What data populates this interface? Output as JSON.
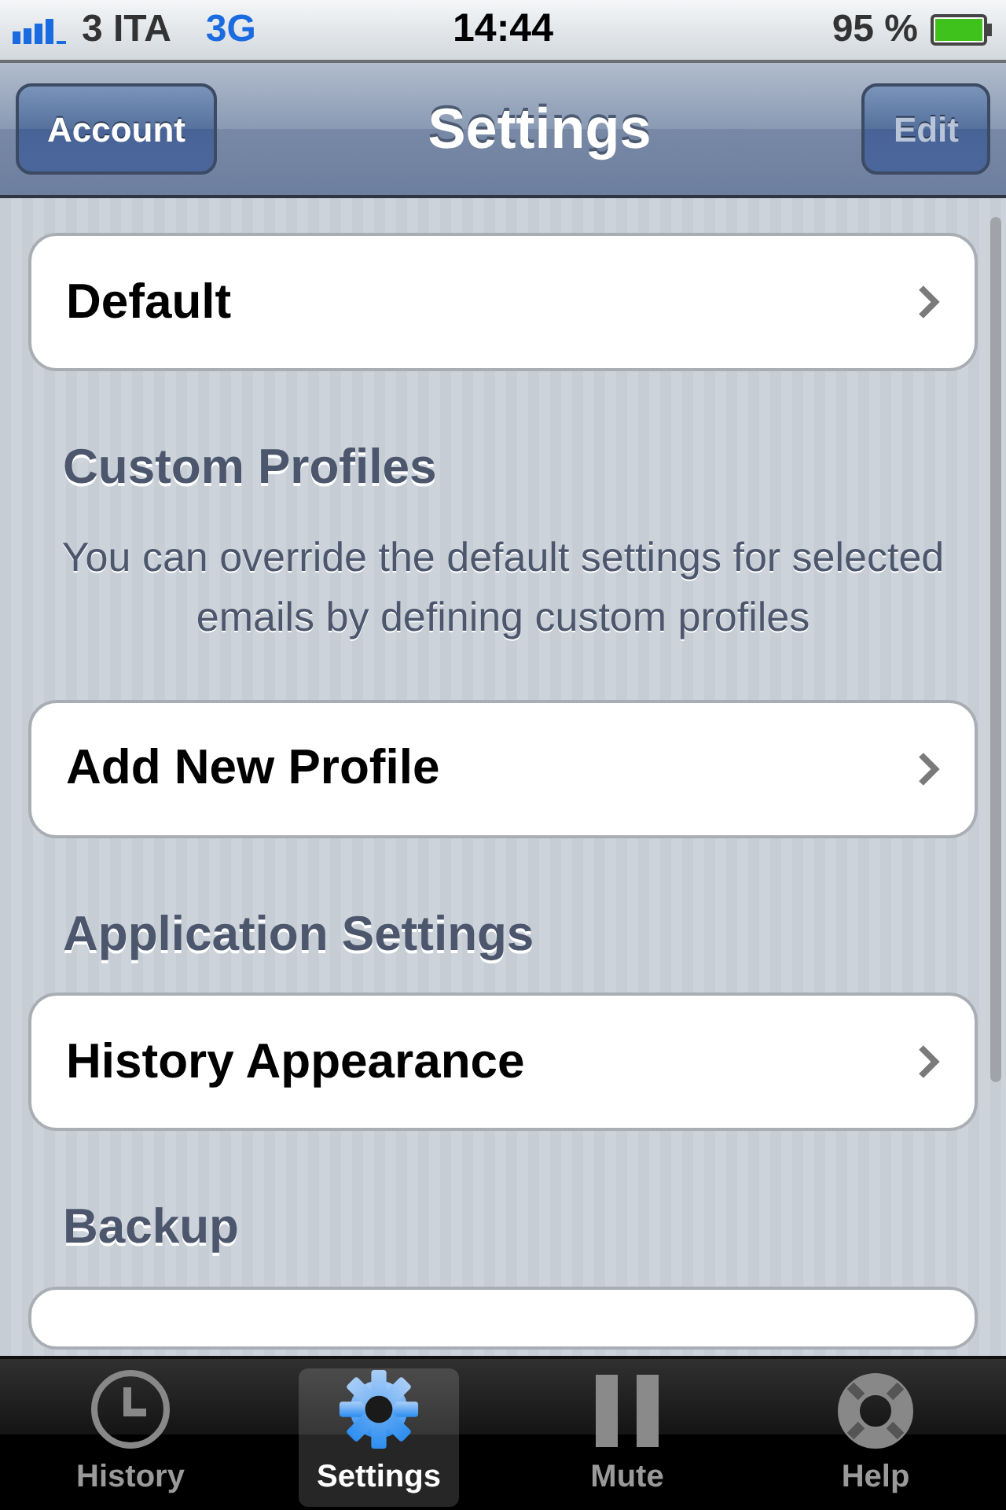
{
  "status_bar": {
    "carrier": "3 ITA",
    "network": "3G",
    "time": "14:44",
    "battery": "95 %"
  },
  "nav_bar": {
    "title": "Settings",
    "left_button": {
      "label": "Account",
      "disabled": false
    },
    "right_button": {
      "label": "Edit",
      "disabled": true
    }
  },
  "sections": [
    {
      "rows": [
        {
          "kind": "link",
          "label": "Default"
        }
      ]
    },
    {
      "header": "Custom Profiles",
      "footer": "You can override the default settings for selected emails by defining custom profiles",
      "rows": [
        {
          "kind": "link",
          "label": "Add New Profile"
        }
      ]
    },
    {
      "header": "Application Settings",
      "rows": [
        {
          "kind": "link",
          "label": "History Appearance"
        }
      ]
    },
    {
      "header": "Backup",
      "rows": [
        {
          "kind": "partial"
        }
      ]
    }
  ],
  "tab_bar": [
    {
      "label": "History",
      "selected": false
    },
    {
      "label": "Settings",
      "selected": true
    },
    {
      "label": "Mute",
      "selected": false
    },
    {
      "label": "Help",
      "selected": false
    }
  ]
}
